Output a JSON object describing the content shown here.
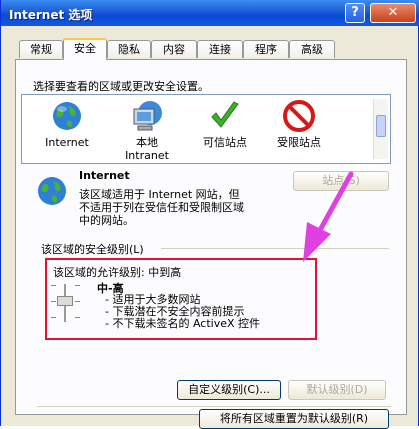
{
  "window": {
    "title": "Internet 选项",
    "help_label": "?",
    "close_label": "✕"
  },
  "tabs": [
    "常规",
    "安全",
    "隐私",
    "内容",
    "连接",
    "程序",
    "高级"
  ],
  "security": {
    "instruction": "选择要查看的区域或更改安全设置。",
    "zones": [
      {
        "label": "Internet",
        "icon": "globe-icon"
      },
      {
        "label": "本地\nIntranet",
        "icon": "computer-icon"
      },
      {
        "label": "可信站点",
        "icon": "checkmark-icon"
      },
      {
        "label": "受限站点",
        "icon": "restricted-icon"
      }
    ],
    "selected_zone": {
      "name": "Internet",
      "description_lines": [
        "该区域适用于 Internet 网站，但",
        "不适用于列在受信任和受限制区域",
        "中的网站。"
      ]
    },
    "sites_button": "站点(S)",
    "level_group_title": "该区域的安全级别(L)",
    "allowed_levels": "该区域的允许级别: 中到高",
    "level_name": "中-高",
    "level_items": [
      "- 适用于大多数网站",
      "- 下载潜在不安全内容前提示",
      "- 不下载未签名的 ActiveX 控件"
    ],
    "custom_level_button": "自定义级别(C)...",
    "default_level_button": "默认级别(D)",
    "reset_all_button": "将所有区域重置为默认级别(R)"
  },
  "colors": {
    "highlight_border": "#e8102a",
    "arrow": "#e040e0"
  }
}
